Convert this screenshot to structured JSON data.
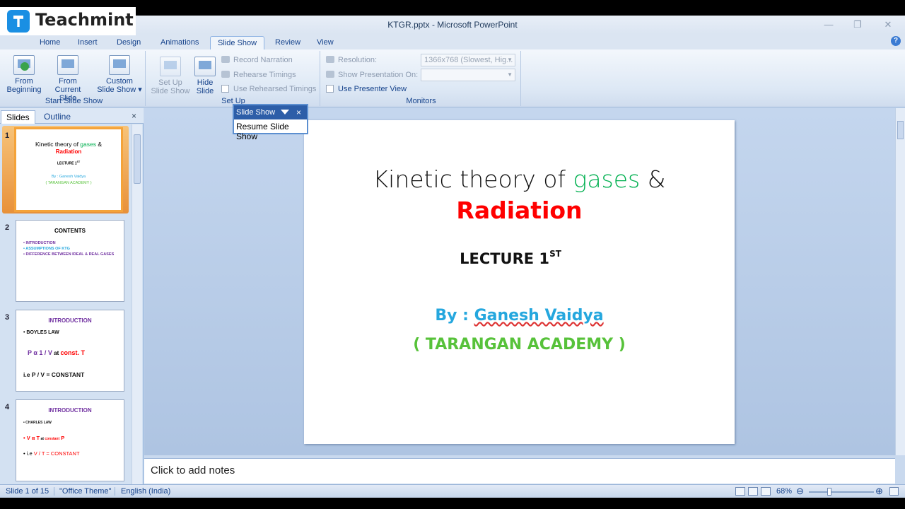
{
  "watermark": {
    "brand": "Teachmint"
  },
  "window": {
    "title": "KTGR.pptx - Microsoft PowerPoint",
    "minimize": "—",
    "restore": "❐",
    "close": "✕"
  },
  "tabs": [
    "Home",
    "Insert",
    "Design",
    "Animations",
    "Slide Show",
    "Review",
    "View"
  ],
  "active_tab": "Slide Show",
  "ribbon": {
    "start_group": {
      "label": "Start Slide Show",
      "from_beginning_1": "From",
      "from_beginning_2": "Beginning",
      "from_current_1": "From",
      "from_current_2": "Current Slide",
      "custom_1": "Custom",
      "custom_2": "Slide Show ▾"
    },
    "setup_group": {
      "label": "Set Up",
      "setup_1": "Set Up",
      "setup_2": "Slide Show",
      "hide_1": "Hide",
      "hide_2": "Slide",
      "record_narration": "Record Narration",
      "rehearse_timings": "Rehearse Timings",
      "use_rehearsed": "Use Rehearsed Timings"
    },
    "monitors_group": {
      "label": "Monitors",
      "resolution_label": "Resolution:",
      "resolution_value": "1366x768 (Slowest, Hig...",
      "show_on_label": "Show Presentation On:",
      "presenter_view": "Use Presenter View"
    }
  },
  "left_panel": {
    "tab_slides": "Slides",
    "tab_outline": "Outline",
    "close": "×",
    "thumbs": [
      {
        "num": "1",
        "title_a": "Kinetic theory of ",
        "title_b": "gases",
        "title_c": " &",
        "title_d": "Radiation",
        "lecture": "LECTURE 1",
        "lecture_sup": "ST",
        "by": "By : Ganesh Vaidya",
        "academy": "( TARANGAN ACADEMY )"
      },
      {
        "num": "2",
        "title": "CONTENTS",
        "items": [
          "• INTRODUCTION",
          "• ASSUMPTIONS OF KTG",
          "• DIFFERENCE BETWEEN  IDEAL  &  REAL GASES"
        ]
      },
      {
        "num": "3",
        "title": "INTRODUCTION",
        "law": "• BOYLES LAW",
        "formula_a": "P α 1 / V",
        "formula_b": " at ",
        "formula_c": "const. T",
        "ie": "i.e P / V = CONSTANT"
      },
      {
        "num": "4",
        "title": "INTRODUCTION",
        "law": "• CHARLES LAW",
        "formula_a": "• V α T",
        "formula_b": " at ",
        "formula_c": "constant",
        "formula_d": " P",
        "ie_a": "• i.e ",
        "ie_b": "V / T = CONSTANT"
      }
    ]
  },
  "slide": {
    "title_a": "Kinetic theory of ",
    "title_b": "gases",
    "title_c": " &",
    "title_d": "Radiation",
    "lecture": "LECTURE 1",
    "lecture_sup": "ST",
    "by_a": "By : ",
    "by_b": "Ganesh Vaidya",
    "academy": "( TARANGAN ACADEMY )"
  },
  "popup": {
    "title": "Slide Show",
    "close": "×",
    "item": "Resume Slide Show"
  },
  "notes": {
    "placeholder": "Click to add notes"
  },
  "status": {
    "slide": "Slide 1 of 15",
    "theme": "\"Office Theme\"",
    "language": "English (India)",
    "zoom": "68%",
    "zoom_out": "⊖",
    "zoom_in": "⊕"
  },
  "colors": {
    "green": "#00b050",
    "red": "#ff0000",
    "blue": "#25a7de",
    "academy_green": "#57c23a",
    "purple": "#7030a0"
  }
}
